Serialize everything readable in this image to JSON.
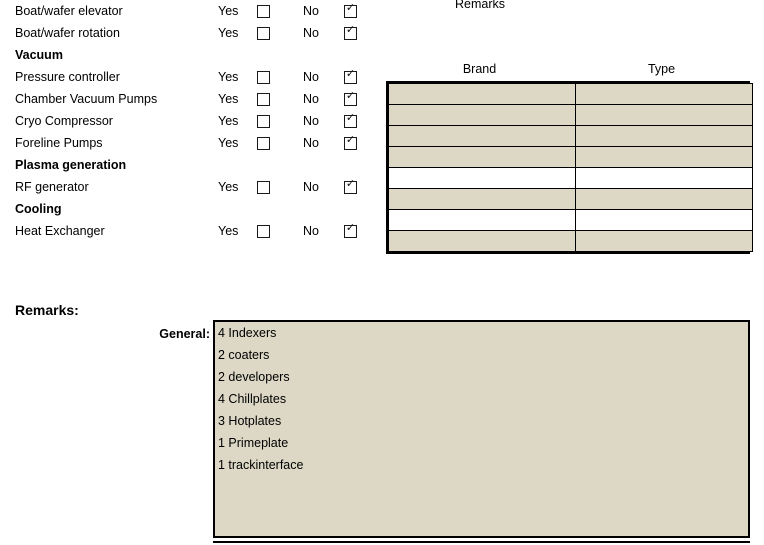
{
  "top_caption": "Remarks",
  "checklist": {
    "yes_label": "Yes",
    "no_label": "No",
    "rows": [
      {
        "label": "Boat/wafer elevator",
        "type": "item",
        "yes": false,
        "no": true
      },
      {
        "label": "Boat/wafer rotation",
        "type": "item",
        "yes": false,
        "no": true
      },
      {
        "label": "Vacuum",
        "type": "section",
        "yes": null,
        "no": null
      },
      {
        "label": "Pressure controller",
        "type": "item",
        "yes": false,
        "no": true
      },
      {
        "label": "Chamber Vacuum Pumps",
        "type": "item",
        "yes": false,
        "no": true
      },
      {
        "label": "Cryo Compressor",
        "type": "item",
        "yes": false,
        "no": true
      },
      {
        "label": "Foreline Pumps",
        "type": "item",
        "yes": false,
        "no": true
      },
      {
        "label": "Plasma generation",
        "type": "section",
        "yes": null,
        "no": null
      },
      {
        "label": "RF generator",
        "type": "item",
        "yes": false,
        "no": true
      },
      {
        "label": "Cooling",
        "type": "section",
        "yes": null,
        "no": null
      },
      {
        "label": "Heat Exchanger",
        "type": "item",
        "yes": false,
        "no": true
      }
    ],
    "checkmark_glyph": "✓"
  },
  "brand_type_table": {
    "headers": [
      "Brand",
      "Type"
    ],
    "rows": [
      {
        "brand": "",
        "type": "",
        "filled": true
      },
      {
        "brand": "",
        "type": "",
        "filled": true
      },
      {
        "brand": "",
        "type": "",
        "filled": true
      },
      {
        "brand": "",
        "type": "",
        "filled": true
      },
      {
        "brand": "",
        "type": "",
        "filled": false
      },
      {
        "brand": "",
        "type": "",
        "filled": true
      },
      {
        "brand": "",
        "type": "",
        "filled": false
      },
      {
        "brand": "",
        "type": "",
        "filled": true
      }
    ]
  },
  "remarks": {
    "title": "Remarks:",
    "general_label": "General:",
    "general_lines": [
      "4 Indexers",
      "2 coaters",
      "2 developers",
      "4 Chillplates",
      "3 Hotplates",
      "1 Primeplate",
      "1 trackinterface"
    ]
  },
  "colors": {
    "field_fill": "#dcd8c5",
    "border": "#000000",
    "page_background": "#ffffff",
    "text": "#000000"
  }
}
